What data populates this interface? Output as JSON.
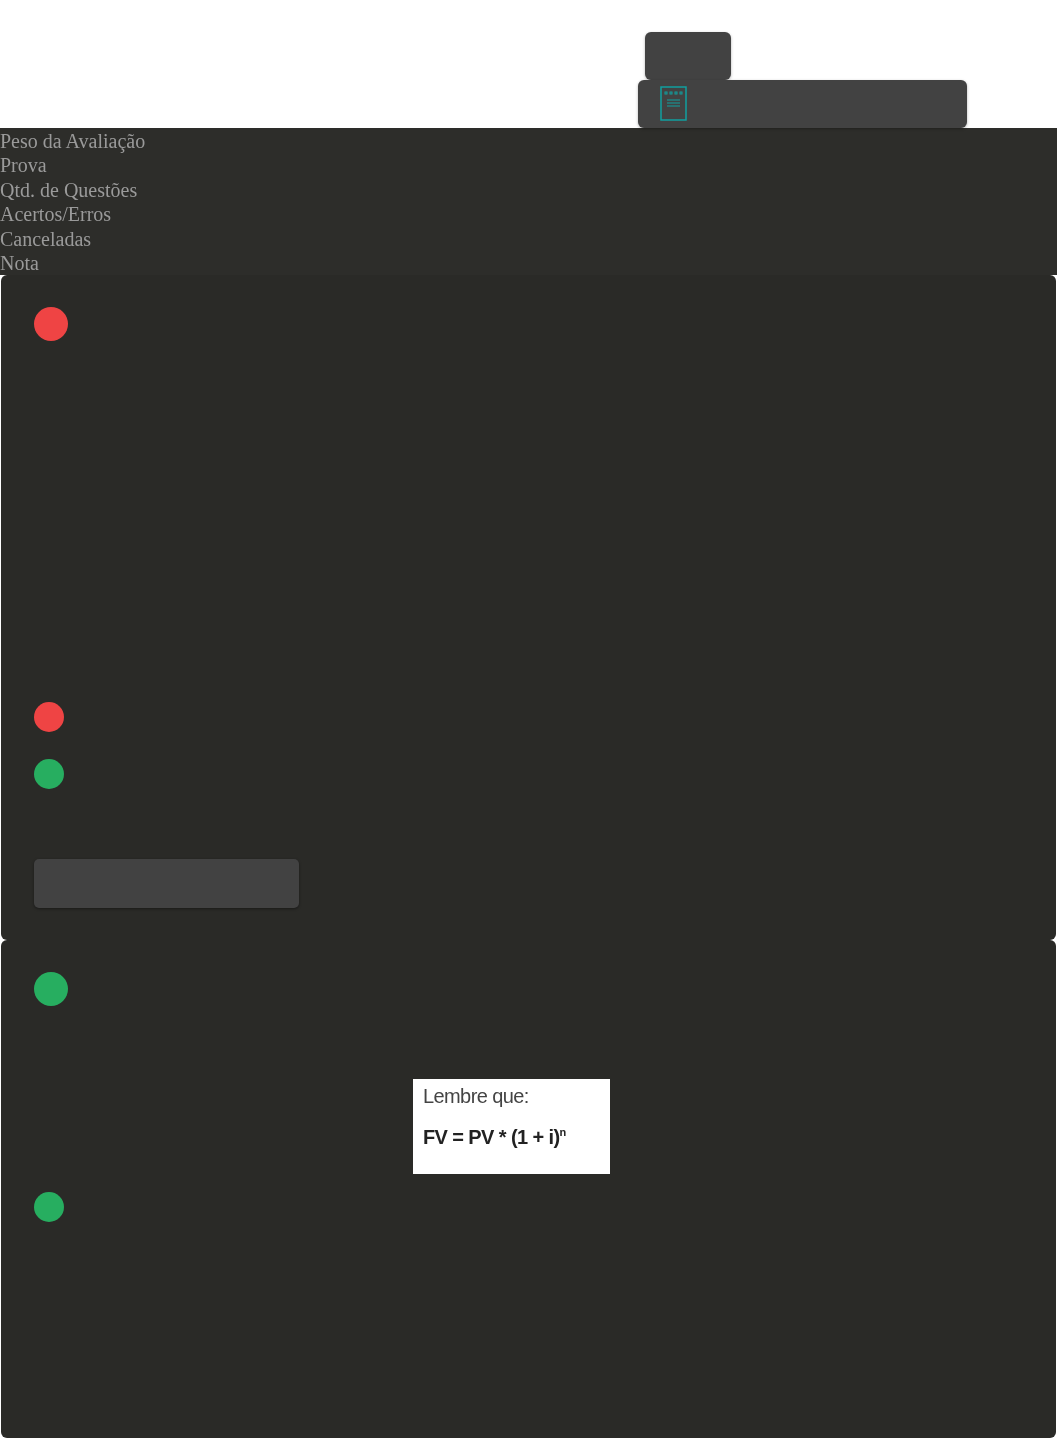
{
  "header_labels": [
    "Peso da Avaliação",
    "Prova",
    "Qtd. de Questões",
    "Acertos/Erros",
    "Canceladas",
    "Nota"
  ],
  "questions": [
    {
      "color": "#ef4444",
      "answers": [
        {
          "color": "#ef4444"
        },
        {
          "color": "#27ae60"
        }
      ],
      "has_button": true
    },
    {
      "color": "#27ae60",
      "figure": {
        "kind": "document",
        "lines": [
          "Lembre que:",
          "**FV = PV * (1 + i)$^{n}$**"
        ]
      },
      "answers": [
        {
          "color": "#27ae60"
        }
      ],
      "has_button": false
    }
  ]
}
